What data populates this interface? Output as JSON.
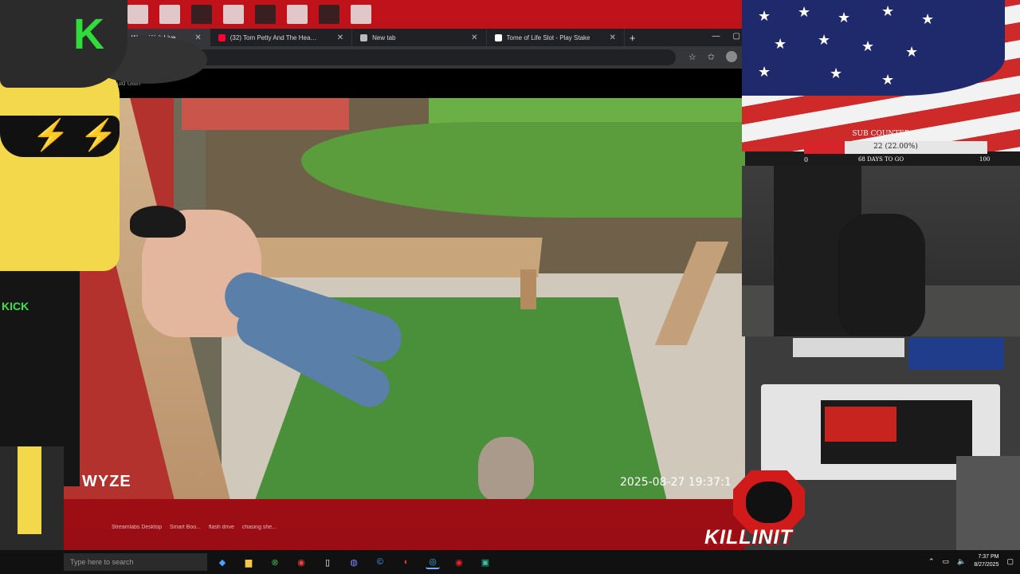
{
  "browser": {
    "tabs": [
      {
        "title": "Wyze Web Live",
        "active": true,
        "icon_color": "#888888"
      },
      {
        "title": "(32) Tom Petty And The Heartbreakers",
        "active": false,
        "icon_color": "#ff0033"
      },
      {
        "title": "New tab",
        "active": false,
        "icon_color": "#bbbbbb"
      },
      {
        "title": "Tome of Life Slot - Play Stake",
        "active": false,
        "icon_color": "#ffffff"
      }
    ],
    "new_tab_symbol": "+",
    "page_label": "Fluid Gain"
  },
  "camera": {
    "logo": "WYZE",
    "timestamp": "2025-08-27 19:37:1"
  },
  "overlay": {
    "cap_letter": "K",
    "shirt_text": "KICK",
    "sub_counter": {
      "title": "SUB COUNTER",
      "value_text": "22 (22.00%)",
      "progress": 0.22,
      "min": "0",
      "max": "100",
      "days_text": "68 DAYS TO GO"
    },
    "brand_text": "KILLINIT"
  },
  "desktop_icons": [
    "Streamlabs Desktop",
    "Smart Boo...",
    "flash drive",
    "chasing she..."
  ],
  "taskbar": {
    "search_placeholder": "Type here to search",
    "time": "7:37 PM",
    "date": "8/27/2025"
  },
  "colors": {
    "accent_green": "#2fdc3a",
    "flag_red": "#cf2a2a",
    "flag_blue": "#1e2a6b",
    "sub_fill": "#d7232a"
  }
}
